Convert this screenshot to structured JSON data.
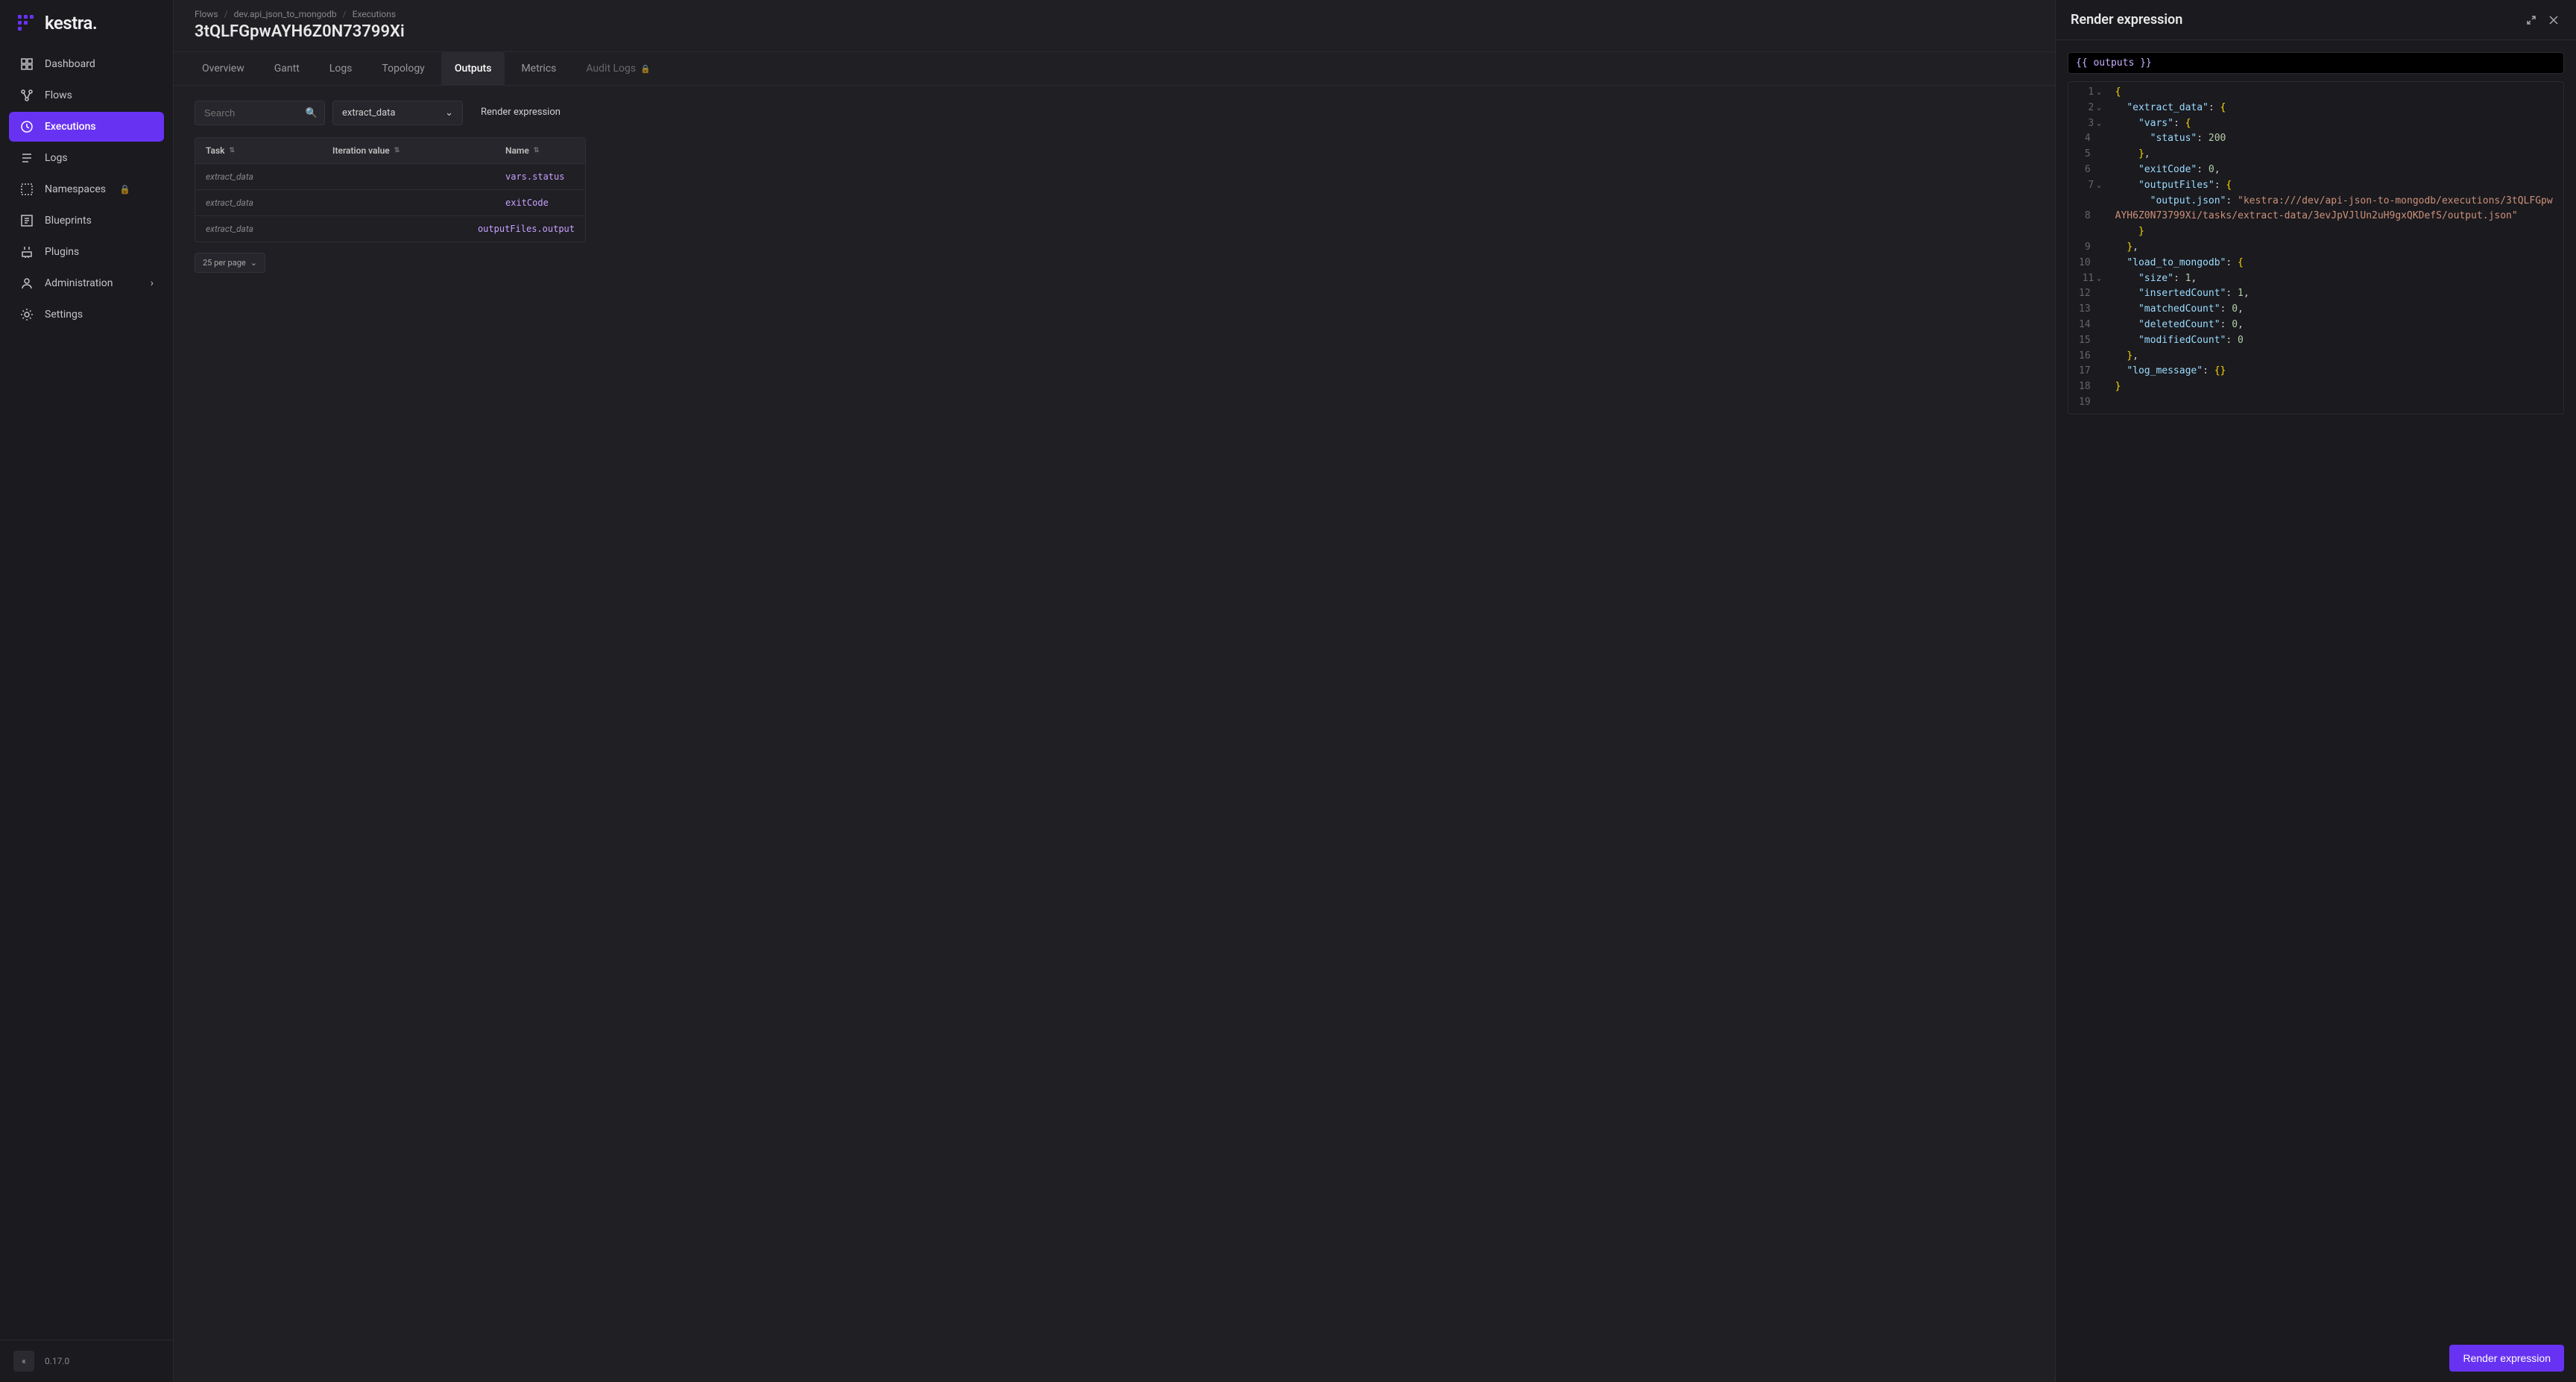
{
  "brand": {
    "name": "kestra."
  },
  "sidebar": {
    "items": [
      {
        "label": "Dashboard",
        "icon": "dashboard"
      },
      {
        "label": "Flows",
        "icon": "flows"
      },
      {
        "label": "Executions",
        "icon": "executions",
        "active": true
      },
      {
        "label": "Logs",
        "icon": "logs"
      },
      {
        "label": "Namespaces",
        "icon": "namespaces",
        "locked": true
      },
      {
        "label": "Blueprints",
        "icon": "blueprints"
      },
      {
        "label": "Plugins",
        "icon": "plugins"
      },
      {
        "label": "Administration",
        "icon": "administration",
        "expandable": true
      },
      {
        "label": "Settings",
        "icon": "settings"
      }
    ],
    "version": "0.17.0"
  },
  "breadcrumb": {
    "parts": [
      "Flows",
      "dev.api_json_to_mongodb",
      "Executions"
    ],
    "title": "3tQLFGpwAYH6Z0N73799Xi"
  },
  "tabs": [
    {
      "label": "Overview"
    },
    {
      "label": "Gantt"
    },
    {
      "label": "Logs"
    },
    {
      "label": "Topology"
    },
    {
      "label": "Outputs",
      "active": true
    },
    {
      "label": "Metrics"
    },
    {
      "label": "Audit Logs",
      "locked": true
    }
  ],
  "outputs": {
    "search_placeholder": "Search",
    "dropdown_value": "extract_data",
    "render_link": "Render expression",
    "columns": {
      "task": "Task",
      "iteration": "Iteration value",
      "name": "Name"
    },
    "rows": [
      {
        "task": "extract_data",
        "name": "vars.status"
      },
      {
        "task": "extract_data",
        "name": "exitCode"
      },
      {
        "task": "extract_data",
        "name": "outputFiles.output"
      }
    ],
    "pager": "25 per page"
  },
  "panel": {
    "title": "Render expression",
    "expression": "{{ outputs }}",
    "button": "Render expression",
    "code": {
      "lines": [
        {
          "n": 1,
          "fold": true,
          "segments": [
            {
              "t": "{",
              "c": "brace"
            }
          ]
        },
        {
          "n": 2,
          "fold": true,
          "indent": 1,
          "segments": [
            {
              "t": "\"extract_data\"",
              "c": "key"
            },
            {
              "t": ": "
            },
            {
              "t": "{",
              "c": "brace"
            }
          ]
        },
        {
          "n": 3,
          "fold": true,
          "indent": 2,
          "segments": [
            {
              "t": "\"vars\"",
              "c": "key"
            },
            {
              "t": ": "
            },
            {
              "t": "{",
              "c": "brace"
            }
          ]
        },
        {
          "n": 4,
          "indent": 3,
          "segments": [
            {
              "t": "\"status\"",
              "c": "key"
            },
            {
              "t": ": "
            },
            {
              "t": "200",
              "c": "number"
            }
          ]
        },
        {
          "n": 5,
          "indent": 2,
          "segments": [
            {
              "t": "}",
              "c": "brace"
            },
            {
              "t": ","
            }
          ]
        },
        {
          "n": 6,
          "indent": 2,
          "segments": [
            {
              "t": "\"exitCode\"",
              "c": "key"
            },
            {
              "t": ": "
            },
            {
              "t": "0",
              "c": "number"
            },
            {
              "t": ","
            }
          ]
        },
        {
          "n": 7,
          "fold": true,
          "indent": 2,
          "segments": [
            {
              "t": "\"outputFiles\"",
              "c": "key"
            },
            {
              "t": ": "
            },
            {
              "t": "{",
              "c": "brace"
            }
          ]
        },
        {
          "n": 8,
          "indent": 3,
          "wrapped": true,
          "segments": [
            {
              "t": "\"output.json\"",
              "c": "key"
            },
            {
              "t": ": "
            },
            {
              "t": "\"kestra:///dev/api-json-to-mongodb/executions/3tQLFGpwAYH6Z0N73799Xi/tasks/extract-data/3evJpVJlUn2uH9gxQKDefS/output.json\"",
              "c": "string"
            }
          ]
        },
        {
          "n": 9,
          "indent": 2,
          "segments": [
            {
              "t": "}",
              "c": "brace"
            }
          ]
        },
        {
          "n": 10,
          "indent": 1,
          "segments": [
            {
              "t": "}",
              "c": "brace"
            },
            {
              "t": ","
            }
          ]
        },
        {
          "n": 11,
          "fold": true,
          "indent": 1,
          "segments": [
            {
              "t": "\"load_to_mongodb\"",
              "c": "key"
            },
            {
              "t": ": "
            },
            {
              "t": "{",
              "c": "brace"
            }
          ]
        },
        {
          "n": 12,
          "indent": 2,
          "segments": [
            {
              "t": "\"size\"",
              "c": "key"
            },
            {
              "t": ": "
            },
            {
              "t": "1",
              "c": "number"
            },
            {
              "t": ","
            }
          ]
        },
        {
          "n": 13,
          "indent": 2,
          "segments": [
            {
              "t": "\"insertedCount\"",
              "c": "key"
            },
            {
              "t": ": "
            },
            {
              "t": "1",
              "c": "number"
            },
            {
              "t": ","
            }
          ]
        },
        {
          "n": 14,
          "indent": 2,
          "segments": [
            {
              "t": "\"matchedCount\"",
              "c": "key"
            },
            {
              "t": ": "
            },
            {
              "t": "0",
              "c": "number"
            },
            {
              "t": ","
            }
          ]
        },
        {
          "n": 15,
          "indent": 2,
          "segments": [
            {
              "t": "\"deletedCount\"",
              "c": "key"
            },
            {
              "t": ": "
            },
            {
              "t": "0",
              "c": "number"
            },
            {
              "t": ","
            }
          ]
        },
        {
          "n": 16,
          "indent": 2,
          "segments": [
            {
              "t": "\"modifiedCount\"",
              "c": "key"
            },
            {
              "t": ": "
            },
            {
              "t": "0",
              "c": "number"
            }
          ]
        },
        {
          "n": 17,
          "indent": 1,
          "segments": [
            {
              "t": "}",
              "c": "brace"
            },
            {
              "t": ","
            }
          ]
        },
        {
          "n": 18,
          "indent": 1,
          "segments": [
            {
              "t": "\"log_message\"",
              "c": "key"
            },
            {
              "t": ": "
            },
            {
              "t": "{}",
              "c": "brace"
            }
          ]
        },
        {
          "n": 19,
          "segments": [
            {
              "t": "}",
              "c": "brace"
            }
          ]
        }
      ]
    }
  }
}
